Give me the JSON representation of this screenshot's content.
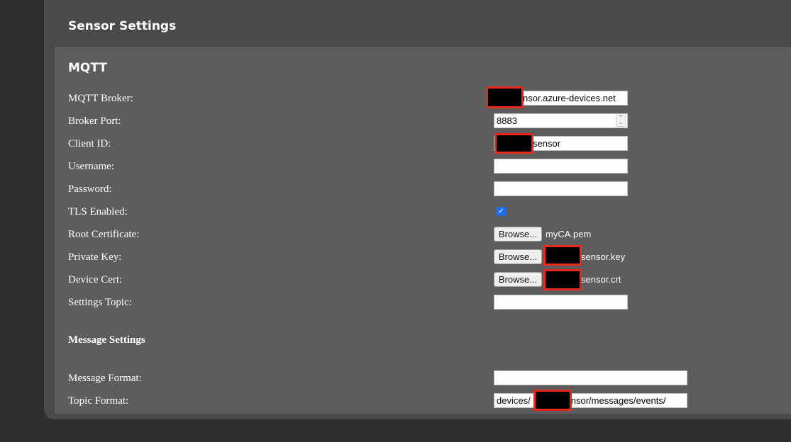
{
  "page": {
    "title": "Sensor Settings",
    "section_title": "MQTT",
    "subsection_title": "Message Settings"
  },
  "fields": {
    "broker": {
      "label": "MQTT Broker:",
      "value": "nsor.azure-devices.net"
    },
    "port": {
      "label": "Broker Port:",
      "value": "8883"
    },
    "client_id": {
      "label": "Client ID:",
      "value": "sensor"
    },
    "username": {
      "label": "Username:",
      "value": ""
    },
    "password": {
      "label": "Password:",
      "value": ""
    },
    "tls": {
      "label": "TLS Enabled:",
      "checked": true,
      "check_glyph": "✓"
    },
    "root_cert": {
      "label": "Root Certificate:",
      "button": "Browse...",
      "file": "myCA.pem"
    },
    "private_key": {
      "label": "Private Key:",
      "button": "Browse...",
      "file": "sensor.key"
    },
    "device_cert": {
      "label": "Device Cert:",
      "button": "Browse...",
      "file": "sensor.crt"
    },
    "settings_topic": {
      "label": "Settings Topic:",
      "value": ""
    },
    "message_format": {
      "label": "Message Format:",
      "value": ""
    },
    "topic_format": {
      "label": "Topic Format:",
      "value": "devices/            sensor/messages/events/"
    }
  },
  "colors": {
    "background": "#2e2e2e",
    "panel": "#4a4a4a",
    "section": "#5d5d5d",
    "checkbox": "#1a6ef5",
    "redaction_border": "#e8291c"
  }
}
